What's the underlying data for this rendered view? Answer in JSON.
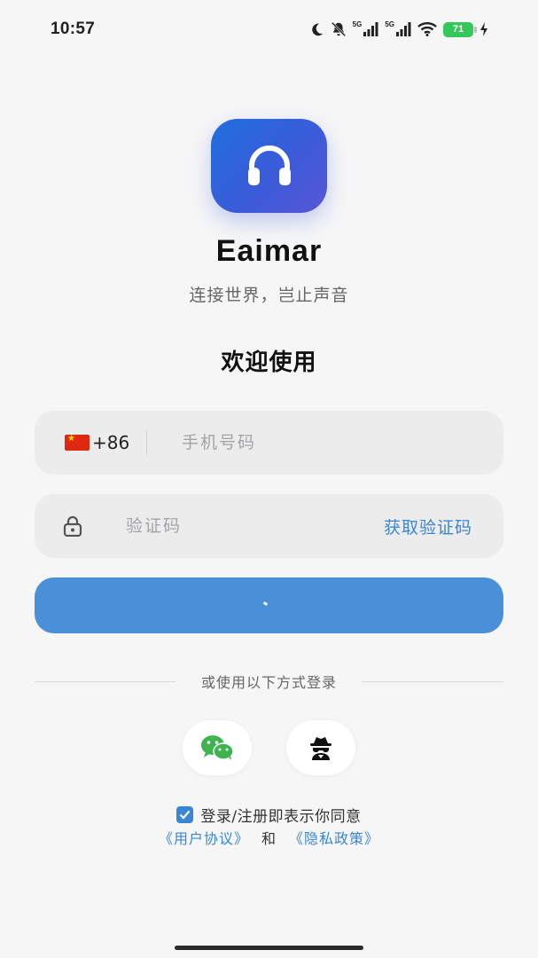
{
  "status_bar": {
    "time": "10:57",
    "battery": "71",
    "signal_label_1": "5G",
    "signal_label_2": "5G",
    "icons": [
      "moon-icon",
      "bell-off-icon",
      "signal-icon",
      "signal-icon",
      "wifi-icon",
      "battery-icon",
      "charging-icon"
    ]
  },
  "app": {
    "name": "Eaimar",
    "slogan": "连接世界，岂止声音",
    "logo_icon": "headphones-icon",
    "brand_color": "#3b5bd9"
  },
  "welcome": "欢迎使用",
  "phone": {
    "country_code": "+86",
    "flag": "china-flag-icon",
    "placeholder": "手机号码",
    "value": ""
  },
  "code": {
    "placeholder": "验证码",
    "value": "",
    "get_code_label": "获取验证码"
  },
  "login_button": {
    "state": "loading",
    "color": "#4a90d9"
  },
  "other_methods": {
    "label": "或使用以下方式登录",
    "options": [
      {
        "icon": "wechat-icon",
        "color": "#3fb34f"
      },
      {
        "icon": "incognito-icon",
        "color": "#111111"
      }
    ]
  },
  "agreement": {
    "checked": true,
    "text": "登录/注册即表示你同意",
    "user_agreement": "《用户协议》",
    "and": "和",
    "privacy_policy": "《隐私政策》",
    "link_color": "#3a86d6"
  }
}
